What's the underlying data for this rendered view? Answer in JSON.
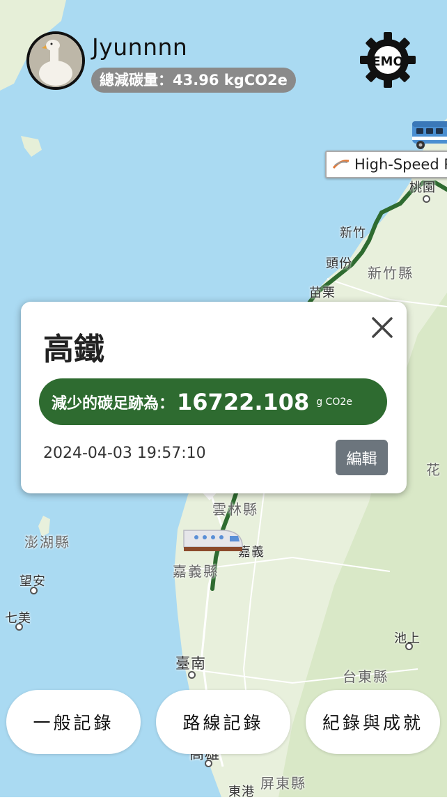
{
  "user": {
    "name": "Jyunnnn",
    "total_reduction": "總減碳量：43.96 kgCO2e"
  },
  "settings_badge": "EMO",
  "map": {
    "rail_label": "High-Speed Ra",
    "places": {
      "taoyuan": "桃園",
      "hsinchu": "新竹",
      "toufen": "頭份",
      "hsinchu_county": "新竹縣",
      "miaoli": "苗栗",
      "hualien": "花",
      "yunlin": "雲林縣",
      "chiayi": "嘉義",
      "chiayi_county": "嘉義縣",
      "penghu": "澎湖縣",
      "wangan": "望安",
      "qimei": "七美",
      "chishang": "池上",
      "taitung_county": "台東縣",
      "tainan": "臺南",
      "kaohsiung": "高雄",
      "pingtung_county": "屏東縣",
      "donggang": "東港"
    }
  },
  "popup": {
    "title": "高鐵",
    "reduction_label": "減少的碳足跡為：",
    "reduction_value": "16722.108",
    "reduction_unit": "g CO2e",
    "timestamp": "2024-04-03 19:57:10",
    "edit_label": "編輯"
  },
  "bottom_nav": {
    "general_record": "一般記錄",
    "route_record": "路線記錄",
    "records_achievements": "紀錄與成就"
  },
  "colors": {
    "sea": "#aadaf2",
    "land": "#e8f0dc",
    "route": "#2e6b30",
    "reduction_bg": "#2e6b30",
    "edit_bg": "#6c757d",
    "pill_bg": "#8a8a8a"
  }
}
